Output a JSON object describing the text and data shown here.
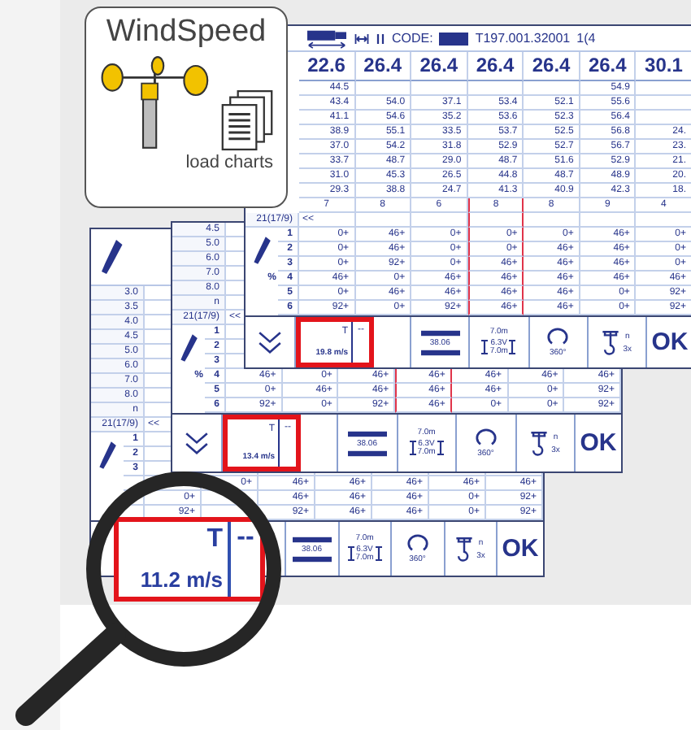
{
  "badge": {
    "title": "WindSpeed",
    "caption": "load charts"
  },
  "screens": [
    {
      "kind": "back",
      "load_rows": [
        {
          "radius": "3.0"
        },
        {
          "radius": "3.5"
        },
        {
          "radius": "4.0"
        },
        {
          "radius": "4.5"
        },
        {
          "radius": "5.0"
        },
        {
          "radius": "6.0"
        },
        {
          "radius": "7.0"
        },
        {
          "radius": "8.0"
        }
      ],
      "tick_label": "n",
      "reeving": {
        "label": "21(17/9)",
        "scroll": "<<"
      },
      "counterweight_rows": [
        {
          "number": "1"
        },
        {
          "number": "2"
        },
        {
          "number": "3"
        },
        {
          "values": [
            {
              "kind": "blank"
            },
            {
              "kind": "value",
              "text": "0+"
            },
            {
              "kind": "value",
              "text": "46+"
            },
            {
              "kind": "value",
              "text": "46+"
            },
            {
              "kind": "value",
              "text": "46+"
            },
            {
              "kind": "value",
              "text": "46+"
            },
            {
              "kind": "value",
              "text": "46+"
            }
          ]
        },
        {
          "values": [
            {
              "kind": "value",
              "text": "0+"
            },
            {
              "kind": "blank"
            },
            {
              "kind": "value",
              "text": "46+"
            },
            {
              "kind": "value",
              "text": "46+"
            },
            {
              "kind": "value",
              "text": "46+"
            },
            {
              "kind": "value",
              "text": "0+"
            },
            {
              "kind": "value",
              "text": "92+"
            }
          ]
        },
        {
          "values": [
            {
              "kind": "value",
              "text": "92+"
            },
            {
              "kind": "blank"
            },
            {
              "kind": "value",
              "text": "92+"
            },
            {
              "kind": "value",
              "text": "46+"
            },
            {
              "kind": "value",
              "text": "46+"
            },
            {
              "kind": "value",
              "text": "0+"
            },
            {
              "kind": "value",
              "text": "92+"
            }
          ]
        }
      ],
      "bar": [
        {
          "kind": "blank"
        },
        {
          "kind": "blank"
        },
        {
          "kind": "blank"
        },
        {
          "kind": "bars",
          "value": "38.06"
        },
        {
          "kind": "span",
          "top": "7.0m",
          "mid": "6.3V",
          "bottom": "7.0m"
        },
        {
          "kind": "rotate",
          "value": "360°"
        },
        {
          "kind": "hook",
          "parts": "n",
          "falls": "3x"
        },
        {
          "kind": "ok",
          "label": "OK"
        }
      ]
    },
    {
      "kind": "middle",
      "columns": [
        {
          "selected": false
        },
        {
          "selected": false
        },
        {
          "selected": false
        },
        {
          "selected": true
        },
        {
          "selected": false
        },
        {
          "selected": false
        },
        {
          "selected": false
        }
      ],
      "load_rows": [
        {
          "radius": "4.5"
        },
        {
          "radius": "5.0"
        },
        {
          "radius": "6.0"
        },
        {
          "radius": "7.0"
        },
        {
          "radius": "8.0"
        }
      ],
      "tick_label": "n",
      "reeving": {
        "label": "21(17/9)",
        "scroll": "<<"
      },
      "unit": "%",
      "counterweight_rows": [
        {
          "number": "1"
        },
        {
          "number": "2"
        },
        {
          "number": "3"
        },
        {
          "number": "4",
          "values": [
            {
              "kind": "value",
              "text": "46+"
            },
            {
              "kind": "value",
              "text": "0+"
            },
            {
              "kind": "value",
              "text": "46+"
            },
            {
              "kind": "value",
              "text": "46+"
            },
            {
              "kind": "value",
              "text": "46+"
            },
            {
              "kind": "value",
              "text": "46+"
            },
            {
              "kind": "value",
              "text": "46+"
            }
          ]
        },
        {
          "number": "5",
          "values": [
            {
              "kind": "value",
              "text": "0+"
            },
            {
              "kind": "value",
              "text": "46+"
            },
            {
              "kind": "value",
              "text": "46+"
            },
            {
              "kind": "value",
              "text": "46+"
            },
            {
              "kind": "value",
              "text": "46+"
            },
            {
              "kind": "value",
              "text": "0+"
            },
            {
              "kind": "value",
              "text": "92+"
            }
          ]
        },
        {
          "number": "6",
          "values": [
            {
              "kind": "value",
              "text": "92+"
            },
            {
              "kind": "value",
              "text": "0+"
            },
            {
              "kind": "value",
              "text": "92+"
            },
            {
              "kind": "value",
              "text": "46+"
            },
            {
              "kind": "value",
              "text": "0+"
            },
            {
              "kind": "value",
              "text": "0+"
            },
            {
              "kind": "value",
              "text": "92+"
            }
          ]
        }
      ],
      "bar": [
        {
          "kind": "chevron"
        },
        {
          "kind": "wind",
          "label": "T",
          "speed": "13.4 m/s",
          "extra": "--"
        },
        {
          "kind": "blank"
        },
        {
          "kind": "bars",
          "value": "38.06"
        },
        {
          "kind": "span",
          "top": "7.0m",
          "mid": "6.3V",
          "bottom": "7.0m"
        },
        {
          "kind": "rotate",
          "value": "360°"
        },
        {
          "kind": "hook",
          "parts": "n",
          "falls": "3x"
        },
        {
          "kind": "ok",
          "label": "OK"
        }
      ]
    },
    {
      "kind": "front",
      "header": {
        "code_label": "CODE:",
        "chart_id": "T197.001.32001",
        "page": "1(4"
      },
      "columns": [
        {
          "length": "22.6",
          "selected": false
        },
        {
          "length": "26.4",
          "selected": false
        },
        {
          "length": "26.4",
          "selected": false
        },
        {
          "length": "26.4",
          "selected": true
        },
        {
          "length": "26.4",
          "selected": false
        },
        {
          "length": "26.4",
          "selected": false
        },
        {
          "length": "30.1",
          "selected": false
        }
      ],
      "load_rows": [
        {
          "values": [
            {
              "kind": "value",
              "text": "44.5"
            },
            {
              "kind": "blank"
            },
            {
              "kind": "blank"
            },
            {
              "kind": "blank"
            },
            {
              "kind": "blank"
            },
            {
              "kind": "value",
              "text": "54.9"
            },
            {
              "kind": "blank"
            }
          ]
        },
        {
          "values": [
            {
              "kind": "value",
              "text": "43.4"
            },
            {
              "kind": "value",
              "text": "54.0"
            },
            {
              "kind": "value",
              "text": "37.1"
            },
            {
              "kind": "value",
              "text": "53.4"
            },
            {
              "kind": "value",
              "text": "52.1"
            },
            {
              "kind": "value",
              "text": "55.6"
            },
            {
              "kind": "blank"
            }
          ]
        },
        {
          "values": [
            {
              "kind": "value",
              "text": "41.1"
            },
            {
              "kind": "value",
              "text": "54.6"
            },
            {
              "kind": "value",
              "text": "35.2"
            },
            {
              "kind": "value",
              "text": "53.6"
            },
            {
              "kind": "value",
              "text": "52.3"
            },
            {
              "kind": "value",
              "text": "56.4"
            },
            {
              "kind": "blank"
            }
          ]
        },
        {
          "values": [
            {
              "kind": "value",
              "text": "38.9"
            },
            {
              "kind": "value",
              "text": "55.1"
            },
            {
              "kind": "value",
              "text": "33.5"
            },
            {
              "kind": "value",
              "text": "53.7"
            },
            {
              "kind": "value",
              "text": "52.5"
            },
            {
              "kind": "value",
              "text": "56.8"
            },
            {
              "kind": "value",
              "text": "24."
            }
          ]
        },
        {
          "values": [
            {
              "kind": "value",
              "text": "37.0"
            },
            {
              "kind": "value",
              "text": "54.2"
            },
            {
              "kind": "value",
              "text": "31.8"
            },
            {
              "kind": "value",
              "text": "52.9"
            },
            {
              "kind": "value",
              "text": "52.7"
            },
            {
              "kind": "value",
              "text": "56.7"
            },
            {
              "kind": "value",
              "text": "23."
            }
          ]
        },
        {
          "values": [
            {
              "kind": "value",
              "text": "33.7"
            },
            {
              "kind": "value",
              "text": "48.7"
            },
            {
              "kind": "value",
              "text": "29.0"
            },
            {
              "kind": "value",
              "text": "48.7"
            },
            {
              "kind": "value",
              "text": "51.6"
            },
            {
              "kind": "value",
              "text": "52.9"
            },
            {
              "kind": "value",
              "text": "21."
            }
          ]
        },
        {
          "values": [
            {
              "kind": "value",
              "text": "31.0"
            },
            {
              "kind": "value",
              "text": "45.3"
            },
            {
              "kind": "value",
              "text": "26.5"
            },
            {
              "kind": "value",
              "text": "44.8"
            },
            {
              "kind": "value",
              "text": "48.7"
            },
            {
              "kind": "value",
              "text": "48.9"
            },
            {
              "kind": "value",
              "text": "20."
            }
          ]
        },
        {
          "values": [
            {
              "kind": "value",
              "text": "29.3"
            },
            {
              "kind": "value",
              "text": "38.8"
            },
            {
              "kind": "value",
              "text": "24.7"
            },
            {
              "kind": "value",
              "text": "41.3"
            },
            {
              "kind": "value",
              "text": "40.9"
            },
            {
              "kind": "value",
              "text": "42.3"
            },
            {
              "kind": "value",
              "text": "18."
            }
          ]
        }
      ],
      "ticks": [
        "7",
        "8",
        "6",
        "8",
        "8",
        "9",
        "4"
      ],
      "reeving": {
        "label": "21(17/9)",
        "scroll": "<<"
      },
      "unit": "%",
      "counterweight_rows": [
        {
          "number": "1",
          "values": [
            {
              "kind": "value",
              "text": "0+"
            },
            {
              "kind": "value",
              "text": "46+"
            },
            {
              "kind": "value",
              "text": "0+"
            },
            {
              "kind": "value",
              "text": "0+"
            },
            {
              "kind": "value",
              "text": "0+"
            },
            {
              "kind": "value",
              "text": "46+"
            },
            {
              "kind": "value",
              "text": "0+"
            }
          ]
        },
        {
          "number": "2",
          "values": [
            {
              "kind": "value",
              "text": "0+"
            },
            {
              "kind": "value",
              "text": "46+"
            },
            {
              "kind": "value",
              "text": "0+"
            },
            {
              "kind": "value",
              "text": "0+"
            },
            {
              "kind": "value",
              "text": "46+"
            },
            {
              "kind": "value",
              "text": "46+"
            },
            {
              "kind": "value",
              "text": "0+"
            }
          ]
        },
        {
          "number": "3",
          "values": [
            {
              "kind": "value",
              "text": "0+"
            },
            {
              "kind": "value",
              "text": "92+"
            },
            {
              "kind": "value",
              "text": "0+"
            },
            {
              "kind": "value",
              "text": "46+"
            },
            {
              "kind": "value",
              "text": "46+"
            },
            {
              "kind": "value",
              "text": "46+"
            },
            {
              "kind": "value",
              "text": "0+"
            }
          ]
        },
        {
          "number": "4",
          "values": [
            {
              "kind": "value",
              "text": "46+"
            },
            {
              "kind": "value",
              "text": "0+"
            },
            {
              "kind": "value",
              "text": "46+"
            },
            {
              "kind": "value",
              "text": "46+"
            },
            {
              "kind": "value",
              "text": "46+"
            },
            {
              "kind": "value",
              "text": "46+"
            },
            {
              "kind": "value",
              "text": "46+"
            }
          ]
        },
        {
          "number": "5",
          "values": [
            {
              "kind": "value",
              "text": "0+"
            },
            {
              "kind": "value",
              "text": "46+"
            },
            {
              "kind": "value",
              "text": "46+"
            },
            {
              "kind": "value",
              "text": "46+"
            },
            {
              "kind": "value",
              "text": "46+"
            },
            {
              "kind": "value",
              "text": "0+"
            },
            {
              "kind": "value",
              "text": "92+"
            }
          ]
        },
        {
          "number": "6",
          "values": [
            {
              "kind": "value",
              "text": "92+"
            },
            {
              "kind": "value",
              "text": "0+"
            },
            {
              "kind": "value",
              "text": "92+"
            },
            {
              "kind": "value",
              "text": "46+"
            },
            {
              "kind": "value",
              "text": "46+"
            },
            {
              "kind": "value",
              "text": "0+"
            },
            {
              "kind": "value",
              "text": "92+"
            }
          ]
        }
      ],
      "bar": [
        {
          "kind": "chevron"
        },
        {
          "kind": "wind",
          "label": "T",
          "speed": "19.8 m/s",
          "extra": "--"
        },
        {
          "kind": "blank"
        },
        {
          "kind": "bars",
          "value": "38.06"
        },
        {
          "kind": "span",
          "top": "7.0m",
          "mid": "6.3V",
          "bottom": "7.0m"
        },
        {
          "kind": "rotate",
          "value": "360°"
        },
        {
          "kind": "hook",
          "parts": "n",
          "falls": "3x"
        },
        {
          "kind": "ok",
          "label": "OK"
        }
      ]
    }
  ],
  "magnifier": {
    "label": "T",
    "speed": "11.2 m/s",
    "extra": "--"
  }
}
